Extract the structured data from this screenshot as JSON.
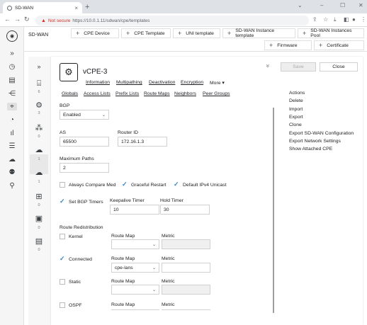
{
  "browser": {
    "tab_title": "SD-WAN",
    "tab_close": "×",
    "new_tab": "+",
    "not_secure": "Not secure",
    "url": "https://10.0.1.11/sdwan/cpe/templates",
    "window_controls": [
      "⌄",
      "–",
      "☐",
      "✕"
    ]
  },
  "app": {
    "title": "SD-WAN",
    "header_buttons": [
      "CPE Device",
      "CPE Template",
      "UNI template",
      "SD-WAN Instance template",
      "SD-WAN Instances Pool",
      "Firmware",
      "Certificate"
    ],
    "plus": "+"
  },
  "rail_icons": [
    "»",
    "◷",
    "▤",
    "⋲",
    "⌖",
    "◔",
    "ıl",
    "☰",
    "☁",
    "⚉",
    "⚲"
  ],
  "side_items": [
    {
      "icon": "router-icon",
      "count": "6"
    },
    {
      "icon": "cpe-icon",
      "count": "3"
    },
    {
      "icon": "hub-icon",
      "count": "0"
    },
    {
      "icon": "cloud-icon",
      "count": "1"
    },
    {
      "icon": "cloud-gear-icon",
      "count": "1"
    },
    {
      "icon": "network-icon",
      "count": "0"
    },
    {
      "icon": "chip-icon",
      "count": "0"
    },
    {
      "icon": "certificate-icon",
      "count": "0"
    }
  ],
  "cpe": {
    "name": "vCPE-3",
    "links": [
      "Information",
      "Multipathing",
      "Deactivation",
      "Encryption",
      "More ▾"
    ],
    "tabs": [
      "Globals",
      "Access Lists",
      "Prefix Lists",
      "Route Maps",
      "Neighbors",
      "Peer Groups"
    ],
    "save": "Save",
    "close": "Close",
    "collapse": "»"
  },
  "form": {
    "bgp_label": "BGP",
    "bgp_value": "Enabled",
    "as_label": "AS",
    "as_value": "65500",
    "router_id_label": "Router ID",
    "router_id_value": "172.16.1.3",
    "max_paths_label": "Maximum Paths",
    "max_paths_value": "2",
    "always_compare_med": "Always Compare Med",
    "graceful_restart": "Graceful Restart",
    "default_ipv4_unicast": "Default IPv4 Unicast",
    "set_bgp_timers": "Set BGP Timers",
    "keepalive_label": "Keepalive Timer",
    "keepalive_value": "10",
    "hold_label": "Hold Timer",
    "hold_value": "30",
    "redistribution_title": "Route Redistribution",
    "route_map_label": "Route Map",
    "metric_label": "Metric",
    "redist": [
      {
        "name": "Kernel",
        "checked": false,
        "route_map": ""
      },
      {
        "name": "Connected",
        "checked": true,
        "route_map": "cpe-lans"
      },
      {
        "name": "Static",
        "checked": false,
        "route_map": ""
      },
      {
        "name": "OSPF",
        "checked": false,
        "route_map": ""
      }
    ]
  },
  "actions": [
    "Actions",
    "Delete",
    "Import",
    "Export",
    "Clone",
    "Export SD-WAN Configuration",
    "Export Network Settings",
    "Show Attached CPE"
  ]
}
